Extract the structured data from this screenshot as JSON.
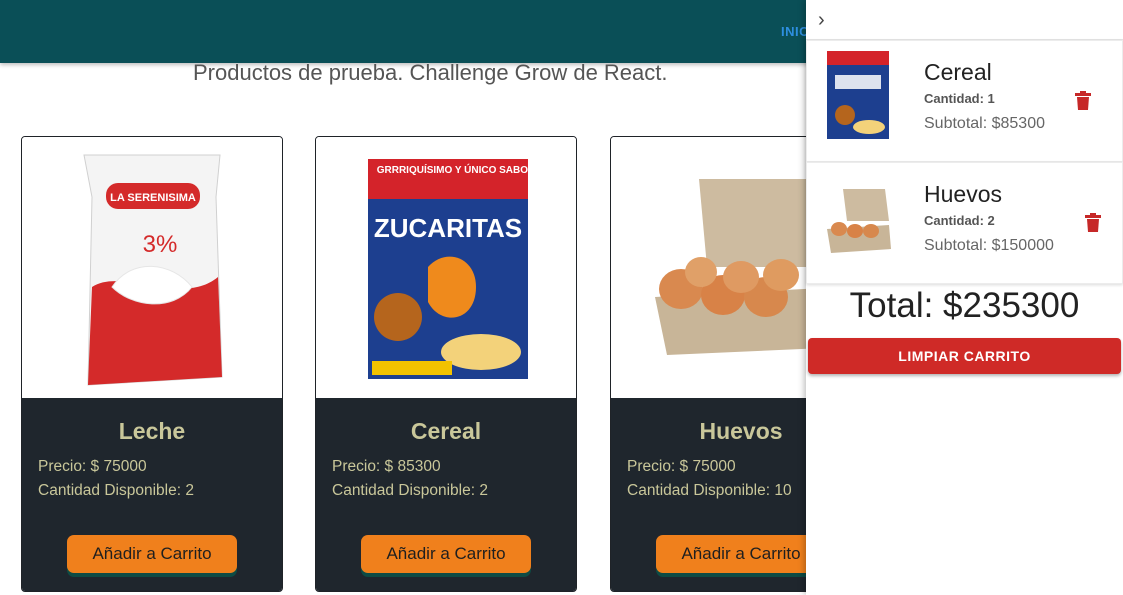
{
  "header": {
    "nav_partial": "INIC"
  },
  "subtitle": "Productos de prueba. Challenge Grow de React.",
  "products": [
    {
      "name": "Leche",
      "price": "Precio: $ 75000",
      "stock": "Cantidad Disponible: 2",
      "button": "Añadir a Carrito",
      "image_icon": "milk-bag-image",
      "brand_label": "LA SERENISIMA",
      "fat_label": "3%"
    },
    {
      "name": "Cereal",
      "price": "Precio: $ 85300",
      "stock": "Cantidad Disponible: 2",
      "button": "Añadir a Carrito",
      "image_icon": "cereal-box-image",
      "banner": "GRRRIQUÍSIMO Y ÚNICO SABOR",
      "box_title": "ZUCARITAS"
    },
    {
      "name": "Huevos",
      "price": "Precio: $ 75000",
      "stock": "Cantidad Disponible: 10",
      "button": "Añadir a Carrito",
      "image_icon": "egg-carton-image"
    }
  ],
  "cart": {
    "collapse_icon": "chevron-right-icon",
    "items": [
      {
        "name": "Cereal",
        "qty": "Cantidad: 1",
        "subtotal": "Subtotal: $85300",
        "delete_icon": "trash-icon"
      },
      {
        "name": "Huevos",
        "qty": "Cantidad: 2",
        "subtotal": "Subtotal: $150000",
        "delete_icon": "trash-icon"
      }
    ],
    "total": "Total: $235300",
    "clear_label": "LIMPIAR CARRITO"
  },
  "colors": {
    "appbar": "#0a4f57",
    "card_body": "#1f262d",
    "card_text": "#c9c79a",
    "button_orange": "#f0801c",
    "clear_red": "#cf2a27",
    "trash_red": "#c62828"
  }
}
